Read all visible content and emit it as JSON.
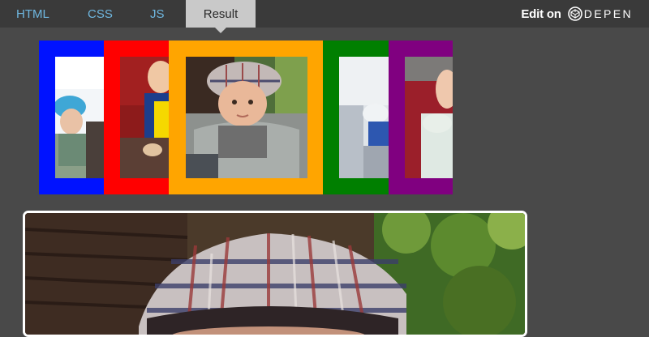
{
  "tabs": {
    "html": "HTML",
    "css": "CSS",
    "js": "JS",
    "result": "Result"
  },
  "editon": {
    "label": "Edit on",
    "brand": "DEPEN"
  },
  "frames": [
    {
      "name": "blue-frame",
      "color": "#0012ff"
    },
    {
      "name": "red-frame",
      "color": "#ff0000"
    },
    {
      "name": "orange-frame",
      "color": "#ffa500"
    },
    {
      "name": "green-frame",
      "color": "#007f00"
    },
    {
      "name": "purple-frame",
      "color": "#800080"
    }
  ],
  "colors": {
    "tab_text": "#6fb7e0",
    "active_tab_bg": "#c9c9c9",
    "topbar_bg": "#3a3a3a",
    "page_bg": "#494949"
  }
}
